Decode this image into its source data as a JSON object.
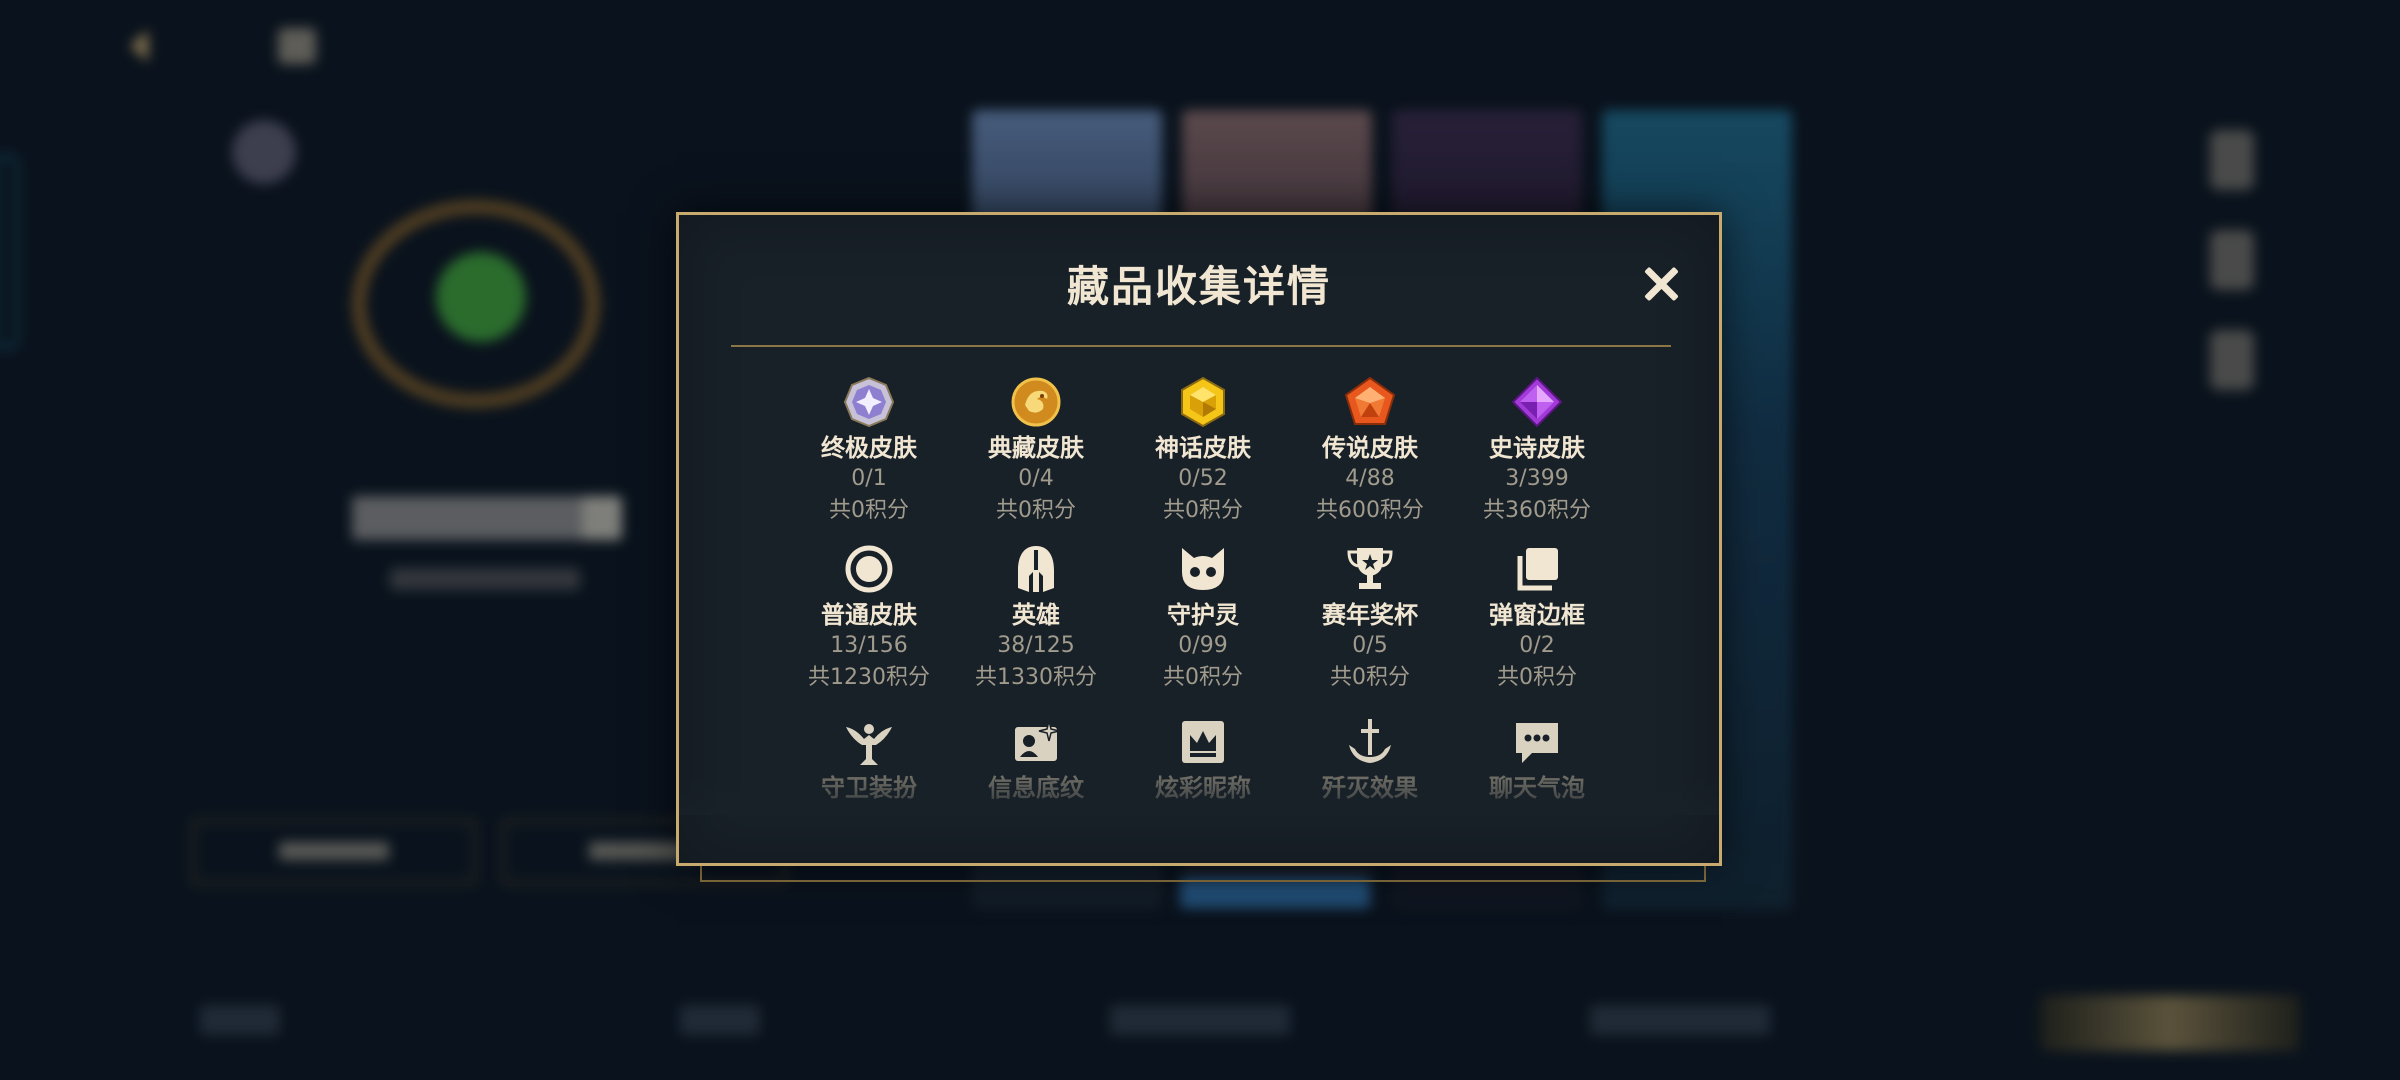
{
  "modal": {
    "title": "藏品收集详情",
    "close_icon": "close-icon"
  },
  "colors": {
    "gold_border": "#c8aa6e",
    "modal_bg": "#182028",
    "text_primary": "#f0e6d2",
    "text_muted": "#a09b8c"
  },
  "categories": [
    {
      "label": "终极皮肤",
      "count": "0/1",
      "points": "共0积分",
      "icon": "ultimate-gem-icon"
    },
    {
      "label": "典藏皮肤",
      "count": "0/4",
      "points": "共0积分",
      "icon": "dragon-coin-icon"
    },
    {
      "label": "神话皮肤",
      "count": "0/52",
      "points": "共0积分",
      "icon": "gold-hexagon-gem-icon"
    },
    {
      "label": "传说皮肤",
      "count": "4/88",
      "points": "共600积分",
      "icon": "orange-pentagon-gem-icon"
    },
    {
      "label": "史诗皮肤",
      "count": "3/399",
      "points": "共360积分",
      "icon": "purple-diamond-gem-icon"
    },
    {
      "label": "普通皮肤",
      "count": "13/156",
      "points": "共1230积分",
      "icon": "circle-icon"
    },
    {
      "label": "英雄",
      "count": "38/125",
      "points": "共1330积分",
      "icon": "helmet-icon"
    },
    {
      "label": "守护灵",
      "count": "0/99",
      "points": "共0积分",
      "icon": "creature-face-icon"
    },
    {
      "label": "赛年奖杯",
      "count": "0/5",
      "points": "共0积分",
      "icon": "trophy-icon"
    },
    {
      "label": "弹窗边框",
      "count": "0/2",
      "points": "共0积分",
      "icon": "stacked-frames-icon"
    },
    {
      "label": "守卫装扮",
      "icon": "ward-totem-icon"
    },
    {
      "label": "信息底纹",
      "icon": "info-card-icon"
    },
    {
      "label": "炫彩昵称",
      "icon": "crown-frame-icon"
    },
    {
      "label": "歼灭效果",
      "icon": "sword-anchor-icon"
    },
    {
      "label": "聊天气泡",
      "icon": "chat-bubble-icon"
    }
  ]
}
